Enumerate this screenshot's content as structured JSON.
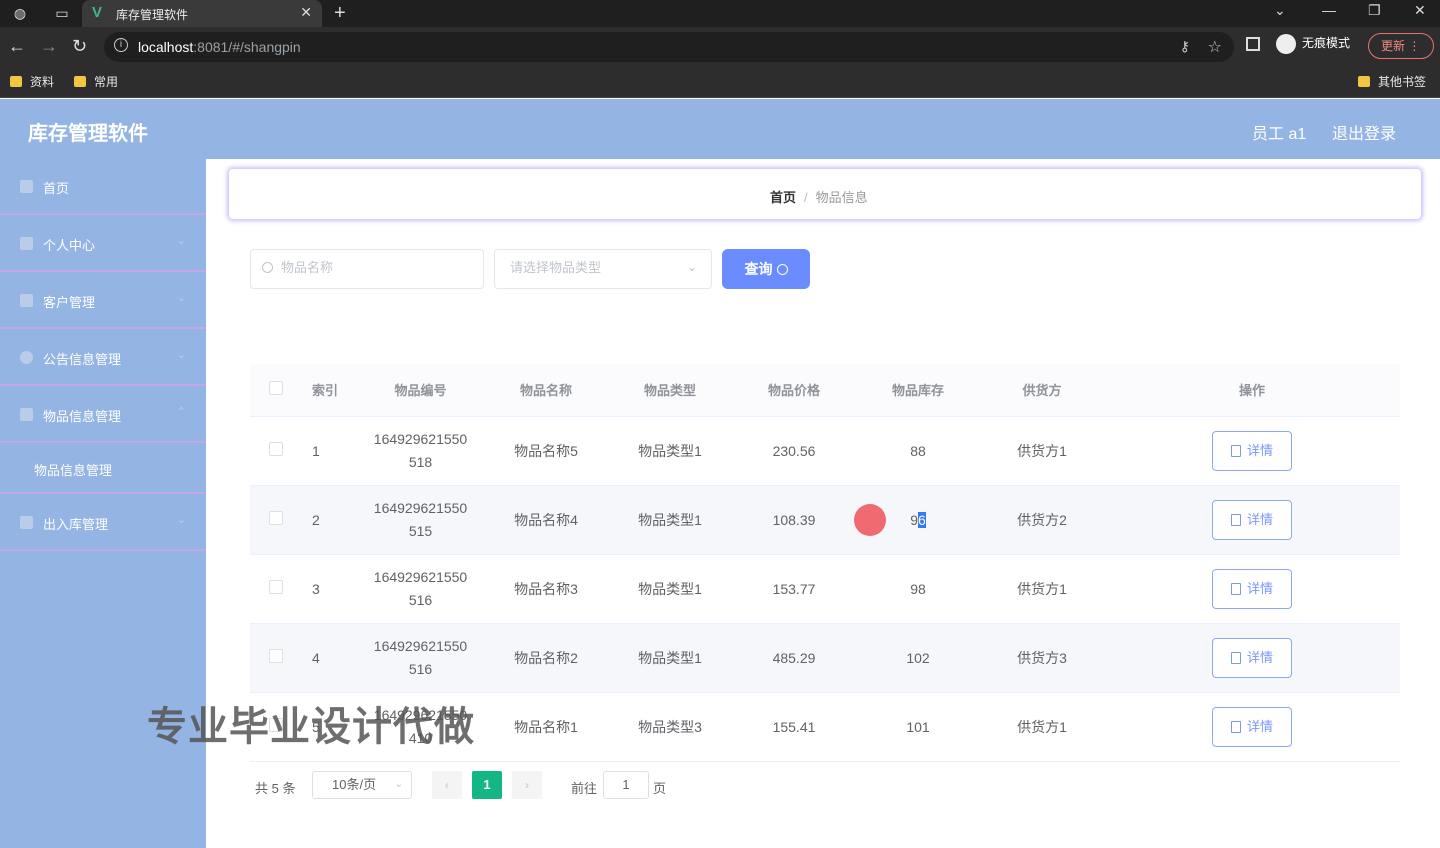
{
  "browser": {
    "tab_title": "库存管理软件",
    "url_host": "localhost",
    "url_rest": ":8081/#/shangpin",
    "incognito_label": "无痕模式",
    "update_label": "更新",
    "bookmarks": [
      "资料",
      "常用"
    ],
    "other_bookmarks": "其他书签"
  },
  "header": {
    "title": "库存管理软件",
    "user": "员工 a1",
    "logout": "退出登录"
  },
  "sidebar": {
    "items": [
      {
        "label": "首页"
      },
      {
        "label": "个人中心"
      },
      {
        "label": "客户管理"
      },
      {
        "label": "公告信息管理"
      },
      {
        "label": "物品信息管理"
      },
      {
        "label": "物品信息管理"
      },
      {
        "label": "出入库管理"
      }
    ]
  },
  "breadcrumb": {
    "home": "首页",
    "current": "物品信息"
  },
  "search": {
    "name_placeholder": "物品名称",
    "type_placeholder": "请选择物品类型",
    "query_label": "查询"
  },
  "table": {
    "headers": [
      "索引",
      "物品编号",
      "物品名称",
      "物品类型",
      "物品价格",
      "物品库存",
      "供货方",
      "操作"
    ],
    "rows": [
      {
        "idx": "1",
        "code1": "164929621550",
        "code2": "518",
        "name": "物品名称5",
        "type": "物品类型1",
        "price": "230.56",
        "stock": "88",
        "supplier": "供货方1"
      },
      {
        "idx": "2",
        "code1": "164929621550",
        "code2": "515",
        "name": "物品名称4",
        "type": "物品类型1",
        "price": "108.39",
        "stock": "96",
        "supplier": "供货方2"
      },
      {
        "idx": "3",
        "code1": "164929621550",
        "code2": "516",
        "name": "物品名称3",
        "type": "物品类型1",
        "price": "153.77",
        "stock": "98",
        "supplier": "供货方1"
      },
      {
        "idx": "4",
        "code1": "164929621550",
        "code2": "516",
        "name": "物品名称2",
        "type": "物品类型1",
        "price": "485.29",
        "stock": "102",
        "supplier": "供货方3"
      },
      {
        "idx": "5",
        "code1": "164929621550",
        "code2": "410",
        "name": "物品名称1",
        "type": "物品类型3",
        "price": "155.41",
        "stock": "101",
        "supplier": "供货方1"
      }
    ],
    "detail_label": "详情"
  },
  "pagination": {
    "total": "共 5 条",
    "page_size": "10条/页",
    "current": "1",
    "goto_label": "前往",
    "goto_value": "1",
    "page_unit": "页"
  },
  "watermark": "专业毕业设计代做"
}
